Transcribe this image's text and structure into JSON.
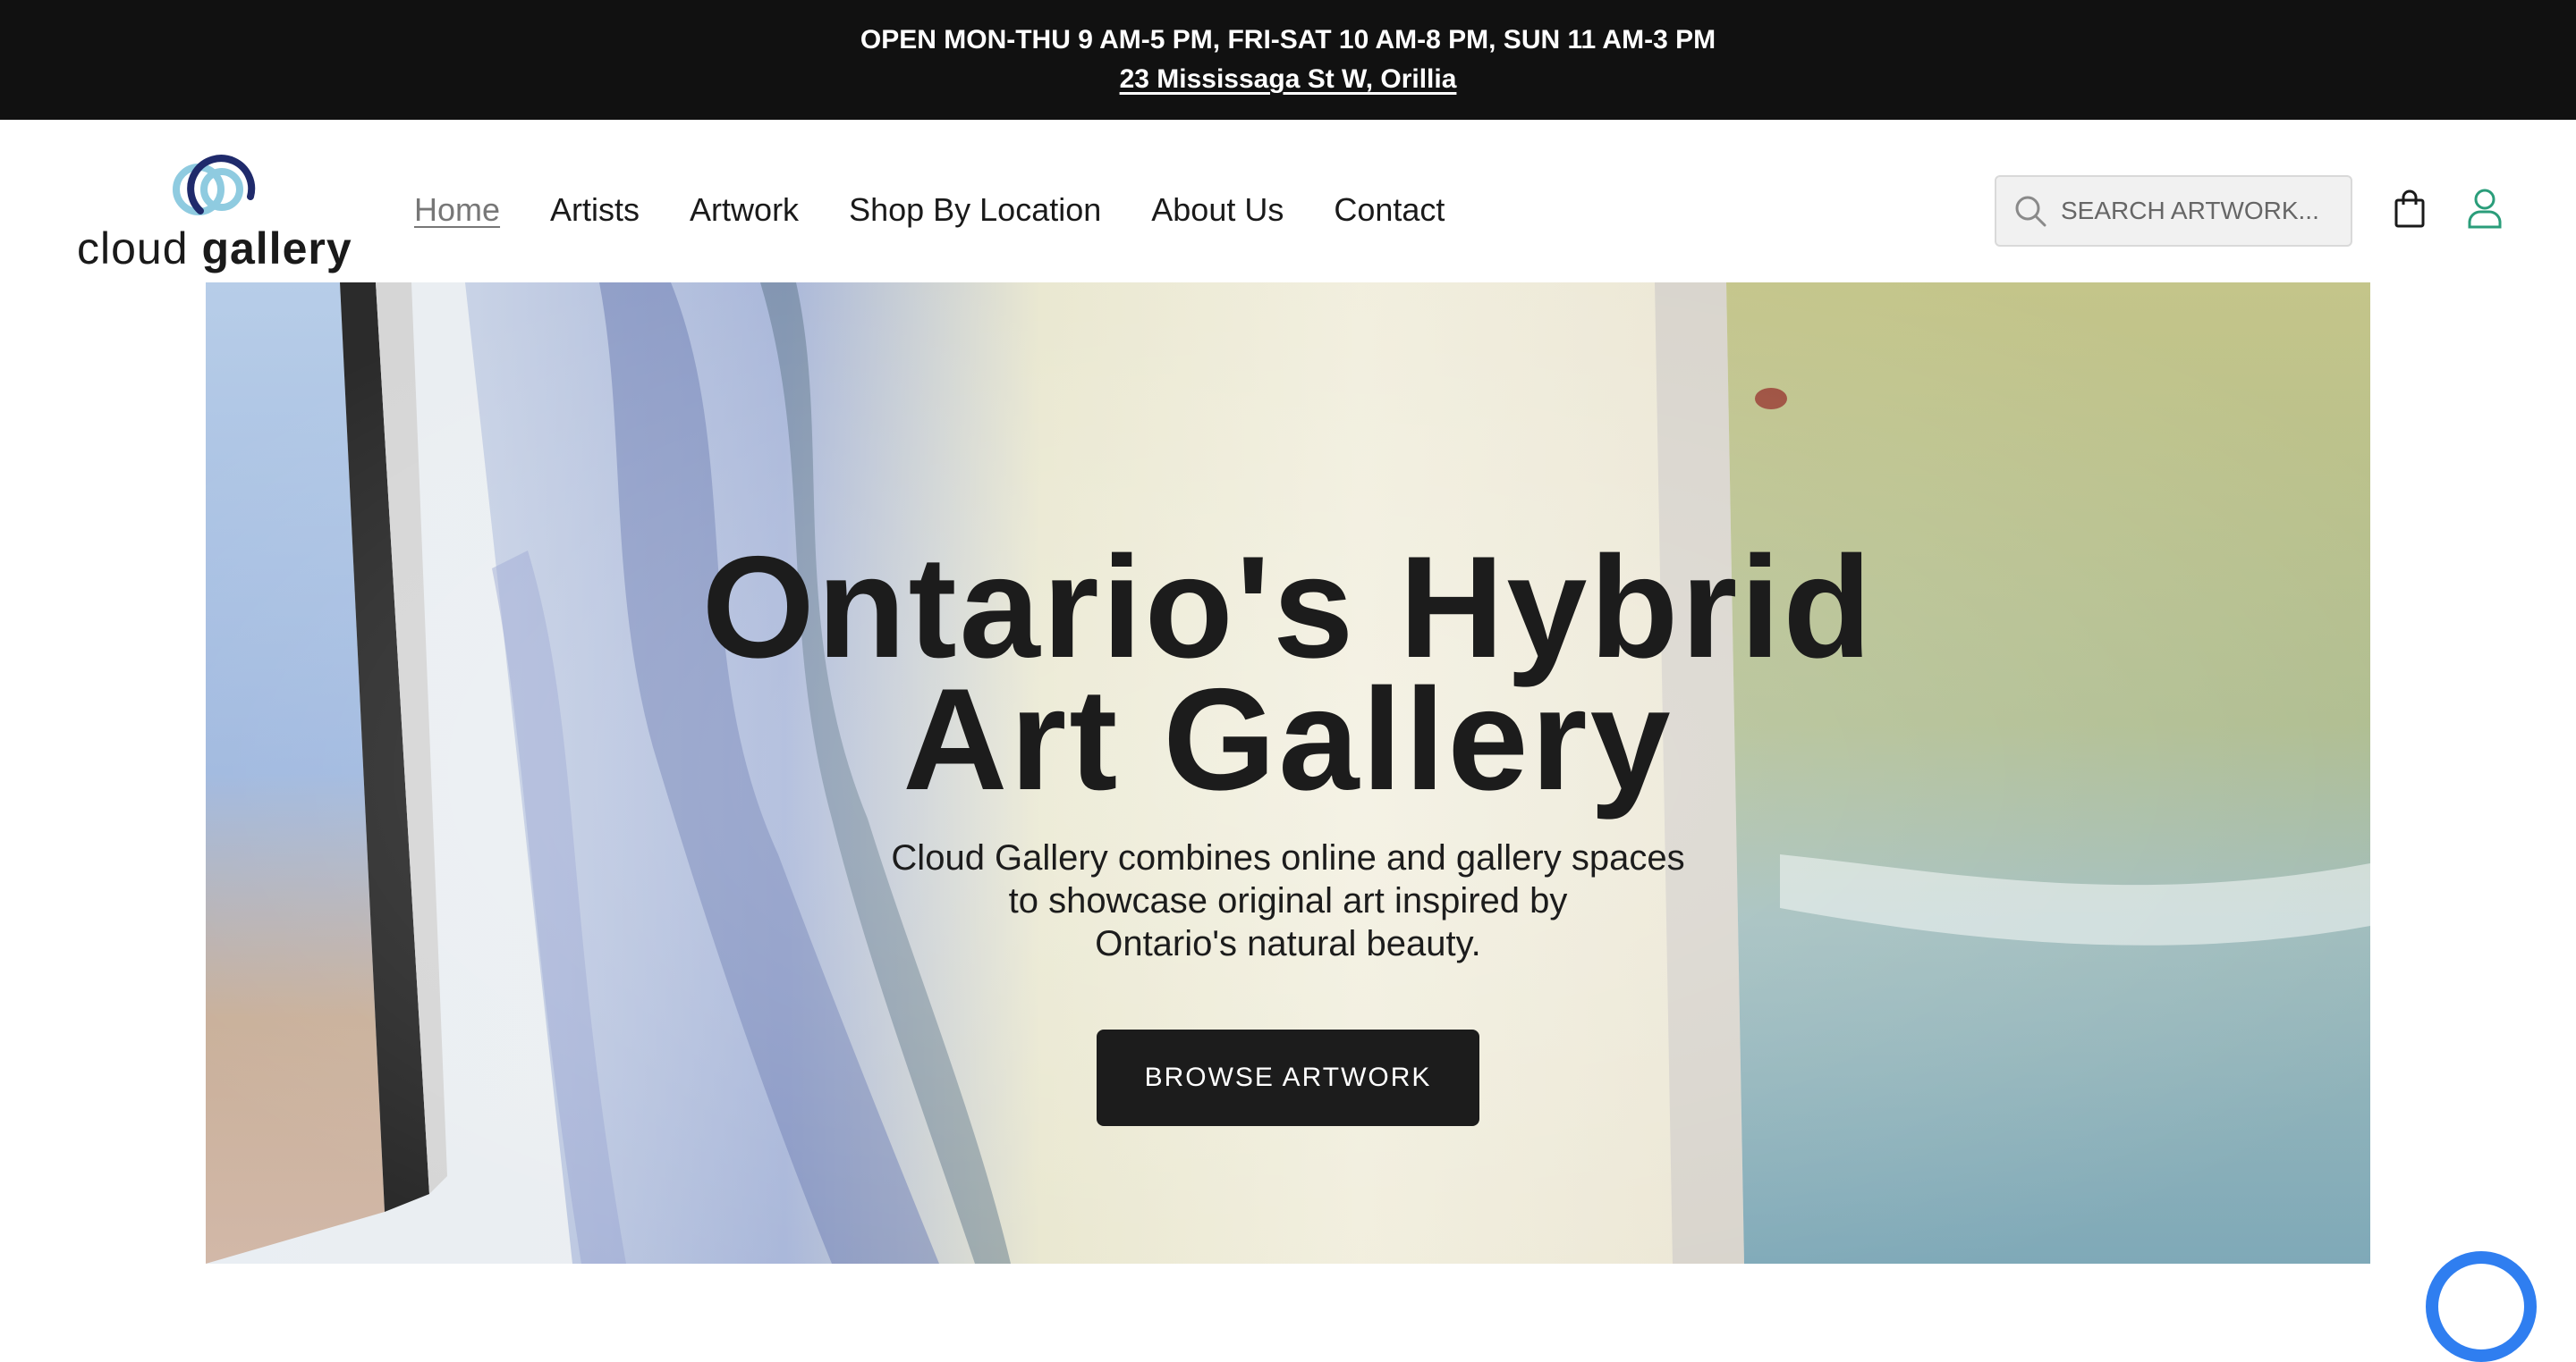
{
  "announcement": {
    "hours": "OPEN MON-THU 9 AM-5 PM, FRI-SAT 10 AM-8 PM, SUN 11 AM-3 PM",
    "address": "23 Mississaga St W, Orillia"
  },
  "logo": {
    "word1": "cloud",
    "word2": "gallery",
    "icon": "cloud-rings-icon"
  },
  "nav": {
    "items": [
      {
        "label": "Home",
        "active": true
      },
      {
        "label": "Artists",
        "active": false
      },
      {
        "label": "Artwork",
        "active": false
      },
      {
        "label": "Shop By Location",
        "active": false
      },
      {
        "label": "About Us",
        "active": false
      },
      {
        "label": "Contact",
        "active": false
      }
    ]
  },
  "search": {
    "placeholder": "SEARCH ARTWORK...",
    "icon": "search-icon"
  },
  "header_icons": {
    "cart": "shopping-bag-icon",
    "account": "user-icon"
  },
  "hero": {
    "title_line1": "Ontario's Hybrid",
    "title_line2": "Art Gallery",
    "subtitle_line1": "Cloud Gallery combines online and gallery spaces",
    "subtitle_line2": "to showcase original art inspired by",
    "subtitle_line3": "Ontario's natural beauty.",
    "button_label": "BROWSE ARTWORK"
  },
  "colors": {
    "announcement_bg": "#111111",
    "accent_green": "#2a9d7a",
    "logo_navy": "#1f2a6b",
    "logo_lightblue": "#8fcbe0",
    "chat_blue": "#2f7ef0",
    "button_dark": "#1c1c1c"
  }
}
